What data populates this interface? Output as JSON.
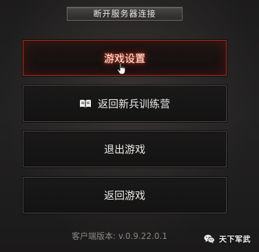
{
  "header": {
    "disconnect_label": "断开服务器连接"
  },
  "menu": {
    "items": [
      {
        "label": "游戏设置",
        "state": "hover"
      },
      {
        "label": "返回新兵训练营",
        "icon": "book-icon"
      },
      {
        "label": "退出游戏"
      },
      {
        "label": "返回游戏"
      }
    ]
  },
  "footer": {
    "version_text": "客户端版本: v.0.9.22.0.1"
  },
  "watermark": {
    "text": "天下军武",
    "icon": "wechat-icon"
  },
  "colors": {
    "background": "#1f1e1e",
    "button_border": "#4d4b49",
    "active_border": "#a43024",
    "active_glow": "#e6462a",
    "text": "#ecebe8",
    "version_text": "#8b8986"
  }
}
